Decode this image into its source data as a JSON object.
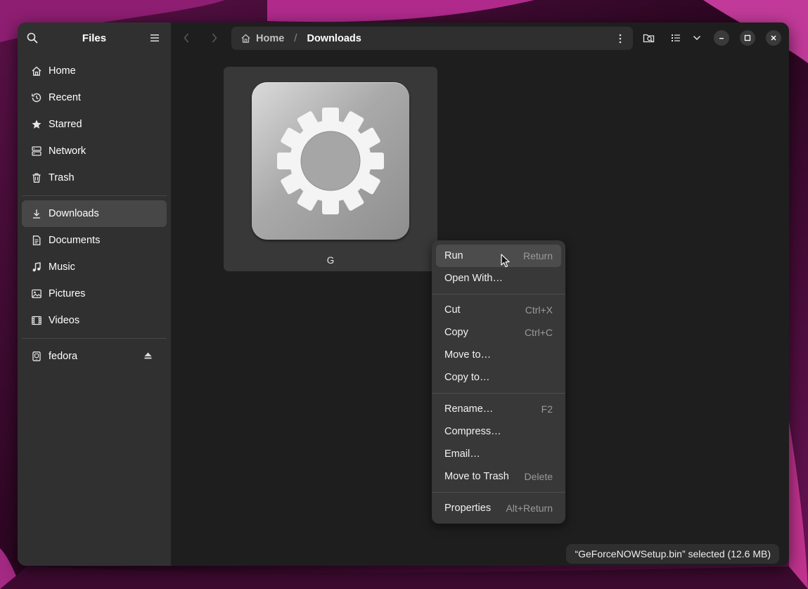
{
  "sidebar": {
    "title": "Files",
    "places": [
      {
        "label": "Home",
        "icon": "home-icon"
      },
      {
        "label": "Recent",
        "icon": "recent-icon"
      },
      {
        "label": "Starred",
        "icon": "star-icon"
      },
      {
        "label": "Network",
        "icon": "network-icon"
      },
      {
        "label": "Trash",
        "icon": "trash-icon"
      }
    ],
    "bookmarks": [
      {
        "label": "Downloads",
        "icon": "download-icon",
        "active": true
      },
      {
        "label": "Documents",
        "icon": "document-icon"
      },
      {
        "label": "Music",
        "icon": "music-icon"
      },
      {
        "label": "Pictures",
        "icon": "pictures-icon"
      },
      {
        "label": "Videos",
        "icon": "videos-icon"
      }
    ],
    "devices": [
      {
        "label": "fedora",
        "icon": "drive-icon",
        "action_icon": "eject-icon"
      }
    ]
  },
  "pathbar": {
    "home_label": "Home",
    "separator": "/",
    "current_label": "Downloads"
  },
  "file": {
    "icon": "executable-gear-icon",
    "label_visible": "G"
  },
  "context_menu": {
    "groups": [
      [
        {
          "label": "Run",
          "accel": "Return",
          "hover": true
        },
        {
          "label": "Open With…",
          "accel": ""
        }
      ],
      [
        {
          "label": "Cut",
          "accel": "Ctrl+X"
        },
        {
          "label": "Copy",
          "accel": "Ctrl+C"
        },
        {
          "label": "Move to…",
          "accel": ""
        },
        {
          "label": "Copy to…",
          "accel": ""
        }
      ],
      [
        {
          "label": "Rename…",
          "accel": "F2"
        },
        {
          "label": "Compress…",
          "accel": ""
        },
        {
          "label": "Email…",
          "accel": ""
        },
        {
          "label": "Move to Trash",
          "accel": "Delete"
        }
      ],
      [
        {
          "label": "Properties",
          "accel": "Alt+Return"
        }
      ]
    ]
  },
  "status": {
    "text": "“GeForceNOWSetup.bin” selected  (12.6 MB)"
  },
  "colors": {
    "window_bg": "#1e1e1e",
    "sidebar_bg": "#303030",
    "menu_bg": "#383838",
    "accent_wallpaper": "#a0207c"
  }
}
